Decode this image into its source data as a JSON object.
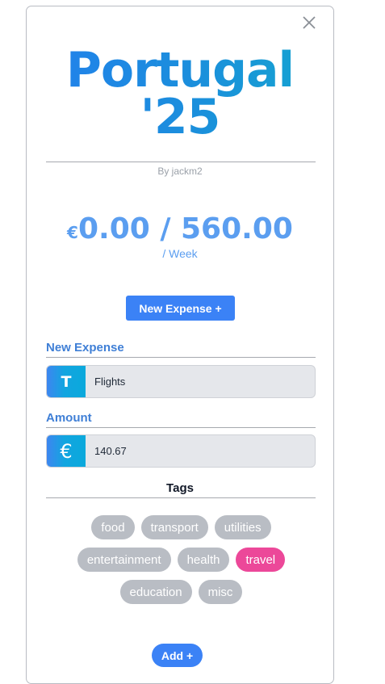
{
  "trip": {
    "title_line1": "Portugal",
    "title_line2": "'25",
    "byline": "By jackm2"
  },
  "budget": {
    "currency_symbol": "€",
    "amount": "0.00 / 560.00",
    "period": "/ Week"
  },
  "actions": {
    "new_expense_label": "New Expense +",
    "add_label": "Add +"
  },
  "form": {
    "expense_label": "New Expense",
    "expense_icon": "T",
    "expense_value": "Flights",
    "amount_label": "Amount",
    "amount_icon": "€",
    "amount_value": "140.67",
    "tags_label": "Tags"
  },
  "tags": [
    {
      "label": "food",
      "selected": false
    },
    {
      "label": "transport",
      "selected": false
    },
    {
      "label": "utilities",
      "selected": false
    },
    {
      "label": "entertainment",
      "selected": false
    },
    {
      "label": "health",
      "selected": false
    },
    {
      "label": "travel",
      "selected": true
    },
    {
      "label": "education",
      "selected": false
    },
    {
      "label": "misc",
      "selected": false
    }
  ],
  "colors": {
    "accent": "#3b82f6",
    "title_gradient_start": "#2280ec",
    "title_gradient_end": "#14a6cf",
    "budget_text": "#5b9ef0",
    "tag_default": "#b9bdc4",
    "tag_selected": "#ec4899"
  },
  "icons": {
    "close": "close-icon",
    "text_field": "text-field-icon",
    "currency": "euro-icon"
  }
}
